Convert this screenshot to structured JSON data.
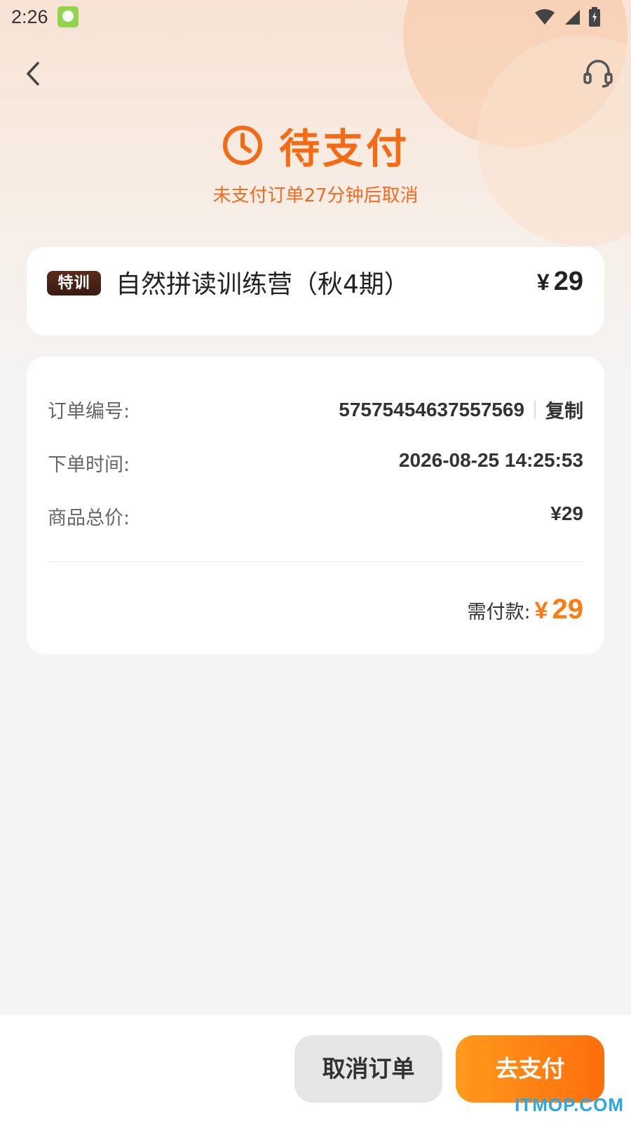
{
  "status_bar": {
    "time": "2:26"
  },
  "header": {
    "back_icon": "chevron-left-icon",
    "service_icon": "headset-icon"
  },
  "status": {
    "title": "待支付",
    "subtitle": "未支付订单27分钟后取消",
    "icon": "clock-icon",
    "accent_color": "#f56a12"
  },
  "product": {
    "tag": "特训",
    "name": "自然拼读训练营（秋4期）",
    "currency": "¥",
    "price": "29"
  },
  "order": {
    "order_no_label": "订单编号:",
    "order_no": "57575454637557569",
    "copy_label": "复制",
    "time_label": "下单时间:",
    "time": "2026-08-25 14:25:53",
    "total_label": "商品总价:",
    "total": "¥29",
    "pay_label": "需付款:",
    "pay_currency": "¥",
    "pay_amount": "29",
    "pay_color": "#ff7a10"
  },
  "actions": {
    "cancel": "取消订单",
    "pay": "去支付"
  },
  "watermark": "ITMOP.COM"
}
